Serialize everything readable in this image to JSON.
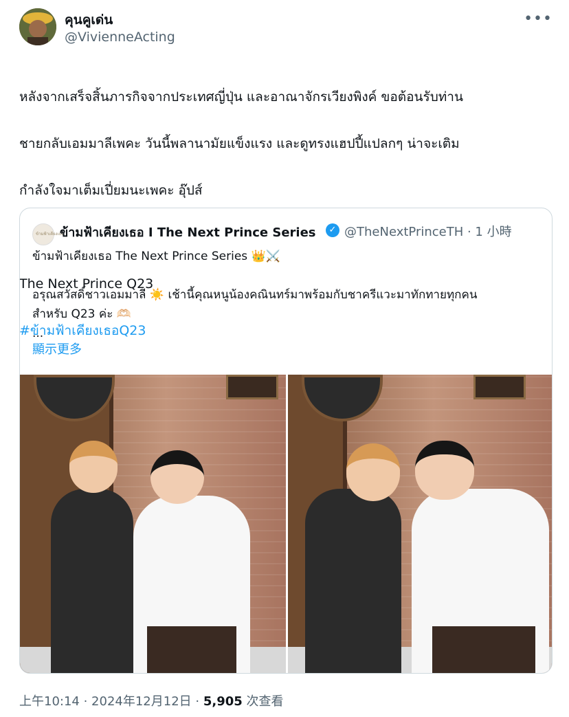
{
  "author": {
    "name": "คุนคูเด่น",
    "handle": "@VivienneActing"
  },
  "menu_icon": "more-icon",
  "tweet": {
    "lines": [
      "หลังจากเสร็จสิ้นภารกิจจากประเทศญี่ปุ่น และอาณาจักรเวียงพิงค์ ขอต้อนรับท่าน",
      "ชายกลับเอมมาลีเพคะ วันนี้พลานามัยแข็งแรง และดูทรงแฮปปี้แปลกๆ น่าจะเติม",
      "กำลังใจมาเต็มเปี่ยมนะเพคะ อุ๊ปส์",
      "",
      "The Next Prince Q23"
    ],
    "hashtag": "#ข้ามฟ้าเคียงเธอQ23"
  },
  "quote": {
    "avatar_text": "ข้ามฟ้าเคียงเธอ",
    "name": "ข้ามฟ้าเคียงเธอ I The Next Prince Series",
    "verified_icon": "verified-icon",
    "handle_time": "@TheNextPrinceTH · 1 小時",
    "text_lines": [
      "ข้ามฟ้าเคียงเธอ The Next Prince Series 👑⚔️",
      "",
      "อรุณสวัสดิ์ชาวเอมมาลี ☀️ เช้านี้คุณหนูน้องคณินทร์มาพร้อมกับชาครีแวะมาทักทายทุกคน",
      "สำหรับ Q23 ค่ะ 🫶🏻",
      "..."
    ],
    "show_more": "顯示更多"
  },
  "footer": {
    "time": "上午10:14 · 2024年12月12日 · ",
    "views_count": "5,905",
    "views_label": " 次查看"
  }
}
